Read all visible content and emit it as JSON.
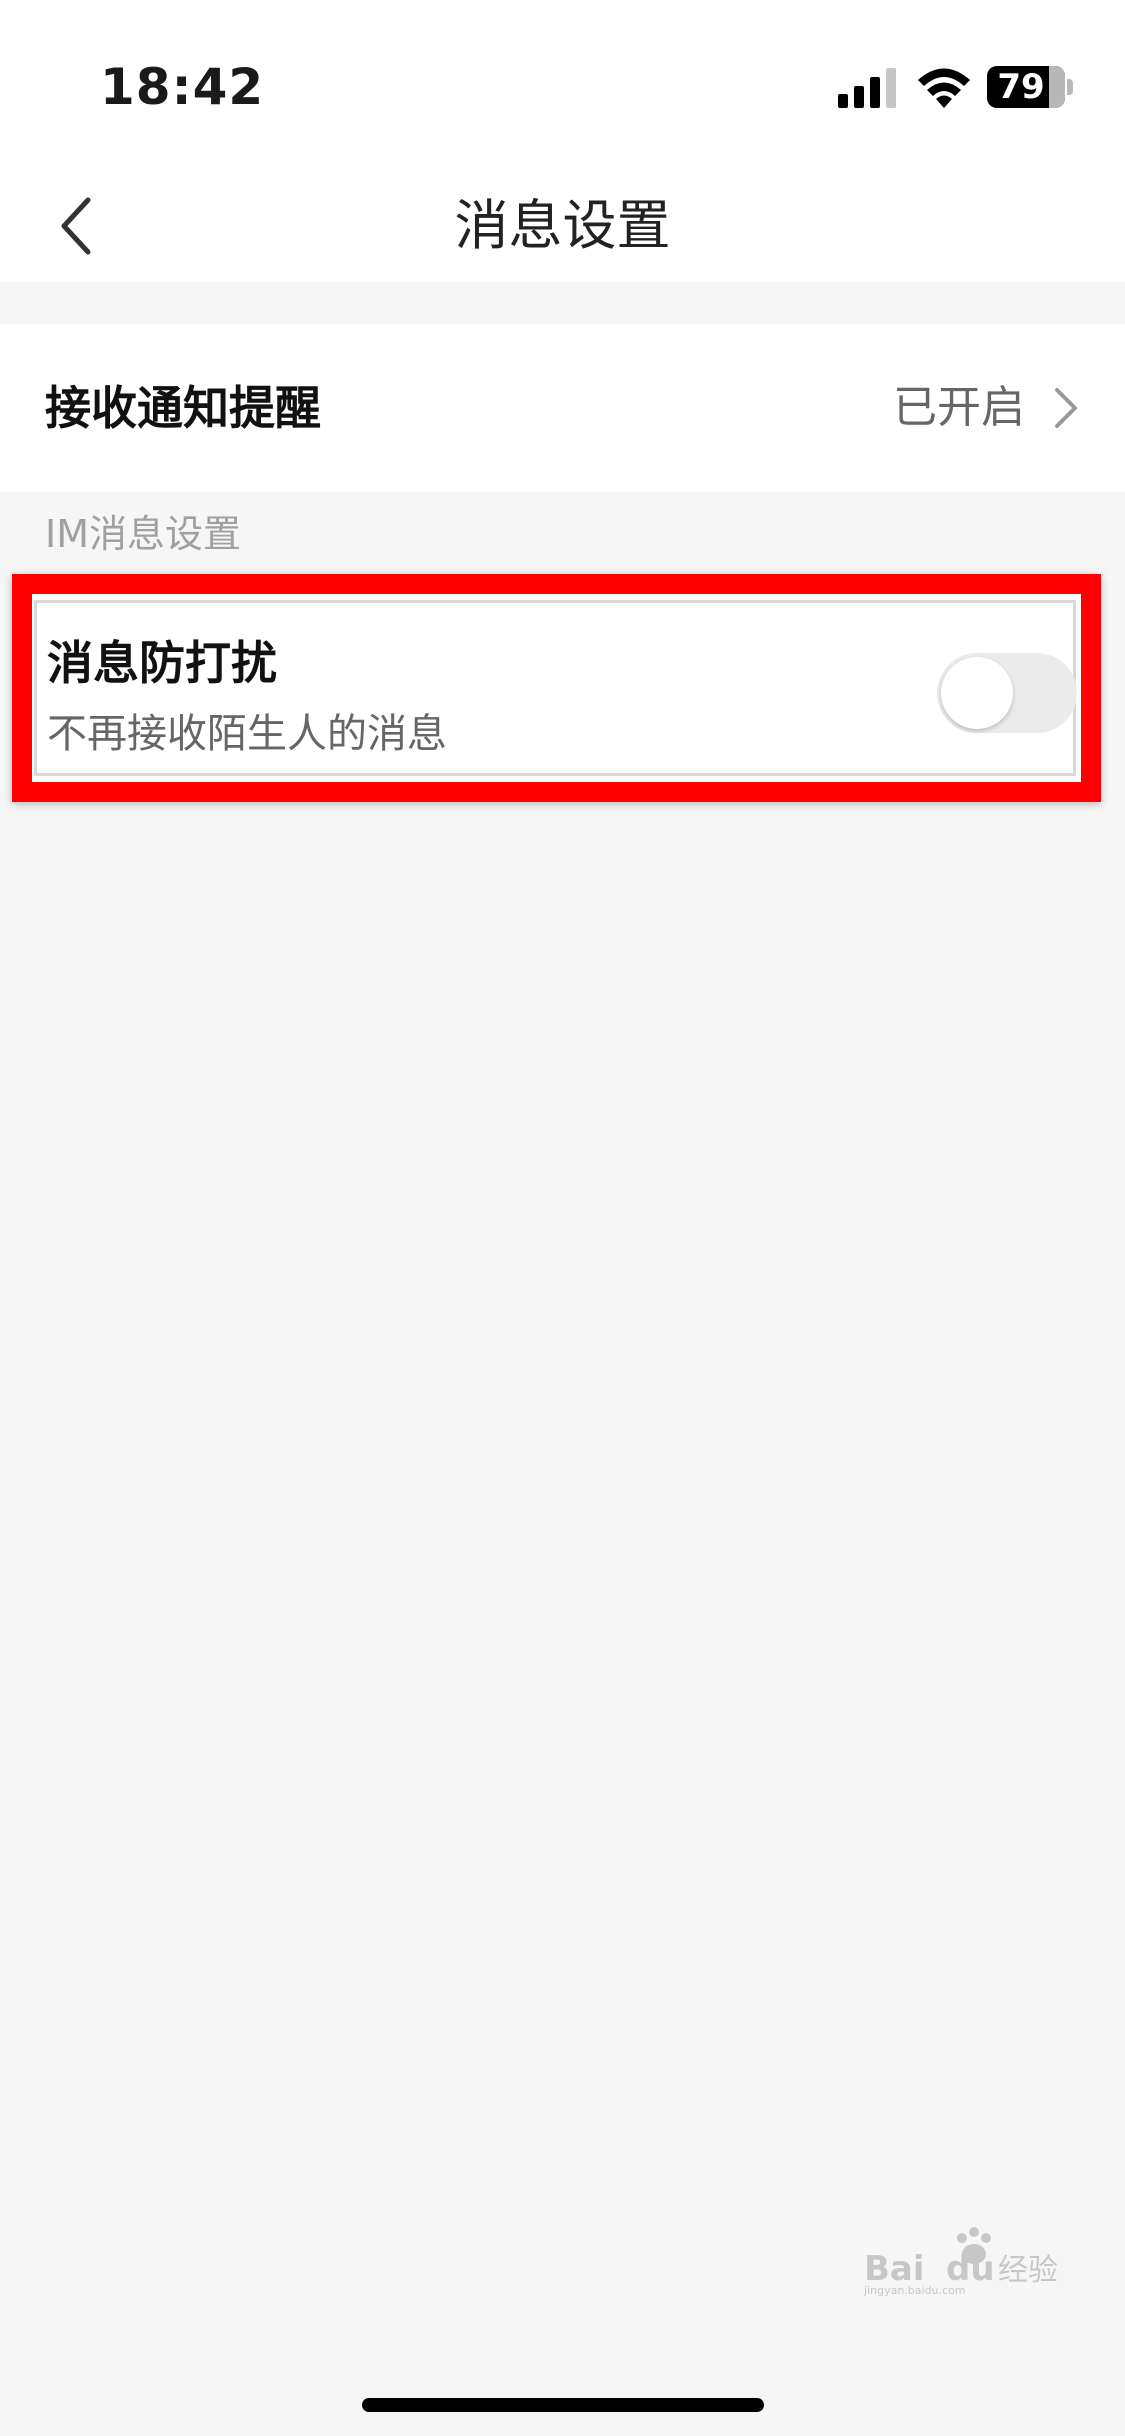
{
  "status_bar": {
    "time": "18:42",
    "battery_level": "79",
    "icons": [
      "signal-icon",
      "wifi-icon",
      "battery-icon"
    ]
  },
  "nav": {
    "title": "消息设置",
    "back_icon": "chevron-left-icon"
  },
  "notify_row": {
    "label": "接收通知提醒",
    "value": "已开启",
    "icon": "chevron-right-icon"
  },
  "im_section": {
    "header": "IM消息设置",
    "dnd": {
      "title": "消息防打扰",
      "subtitle": "不再接收陌生人的消息",
      "enabled": false
    }
  },
  "annotation": {
    "highlight_color": "#ff0000"
  },
  "watermark": {
    "text": "Bai du 经验",
    "subtext": "jingyan.baidu.com"
  }
}
